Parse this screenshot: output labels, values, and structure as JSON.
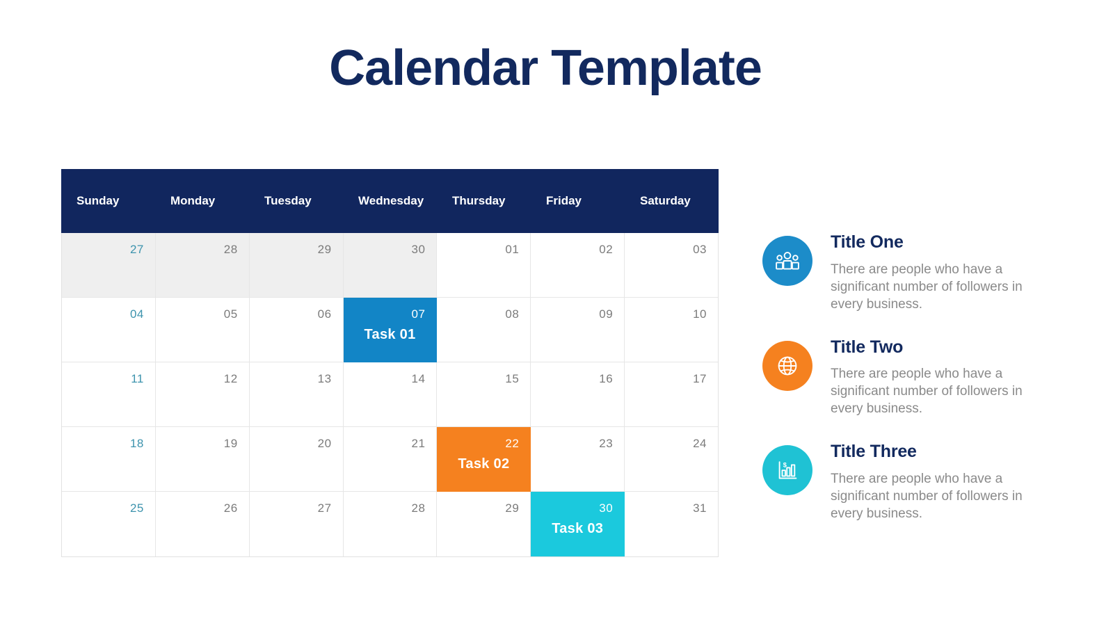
{
  "page": {
    "title": "Calendar Template",
    "title_color": "#12295e",
    "background": "#ffffff"
  },
  "calendar": {
    "header_background": "#11265e",
    "header_text_color": "#ffffff",
    "days": [
      {
        "label": "Sunday"
      },
      {
        "label": "Monday"
      },
      {
        "label": "Tuesday"
      },
      {
        "label": "Wednesday"
      },
      {
        "label": "Thursday"
      },
      {
        "label": "Friday"
      },
      {
        "label": "Saturday"
      }
    ],
    "muted_cell_color": "#efefef",
    "sunday_date_color": "#3d93ad",
    "date_color": "#7b7b7b",
    "task_colors": {
      "task_01": "#1285c6",
      "task_02": "#f5811f",
      "task_03": "#1bc9dd"
    },
    "weeks": [
      [
        {
          "date": "27",
          "muted": true,
          "sunday": true
        },
        {
          "date": "28",
          "muted": true
        },
        {
          "date": "29",
          "muted": true
        },
        {
          "date": "30",
          "muted": true
        },
        {
          "date": "01"
        },
        {
          "date": "02"
        },
        {
          "date": "03"
        }
      ],
      [
        {
          "date": "04",
          "sunday": true
        },
        {
          "date": "05"
        },
        {
          "date": "06"
        },
        {
          "date": "07",
          "task": "Task 01",
          "task_style": "task-blue"
        },
        {
          "date": "08"
        },
        {
          "date": "09"
        },
        {
          "date": "10"
        }
      ],
      [
        {
          "date": "11",
          "sunday": true
        },
        {
          "date": "12"
        },
        {
          "date": "13"
        },
        {
          "date": "14"
        },
        {
          "date": "15"
        },
        {
          "date": "16"
        },
        {
          "date": "17"
        }
      ],
      [
        {
          "date": "18",
          "sunday": true
        },
        {
          "date": "19"
        },
        {
          "date": "20"
        },
        {
          "date": "21"
        },
        {
          "date": "22",
          "task": "Task 02",
          "task_style": "task-orange"
        },
        {
          "date": "23"
        },
        {
          "date": "24"
        }
      ],
      [
        {
          "date": "25",
          "sunday": true
        },
        {
          "date": "26"
        },
        {
          "date": "27"
        },
        {
          "date": "28"
        },
        {
          "date": "29"
        },
        {
          "date": "30",
          "task": "Task 03",
          "task_style": "task-cyan"
        },
        {
          "date": "31"
        }
      ]
    ]
  },
  "features": [
    {
      "icon": "people-group-icon",
      "icon_color": "#1c8cc9",
      "title": "Title One",
      "description": "There are people who have a significant number of followers in every business."
    },
    {
      "icon": "globe-icon",
      "icon_color": "#f5811f",
      "title": "Title Two",
      "description": "There are people who have a significant number of followers in every business."
    },
    {
      "icon": "bar-chart-dollar-icon",
      "icon_color": "#1fc2d4",
      "title": "Title Three",
      "description": "There are people who have a significant number of followers in every business."
    }
  ]
}
